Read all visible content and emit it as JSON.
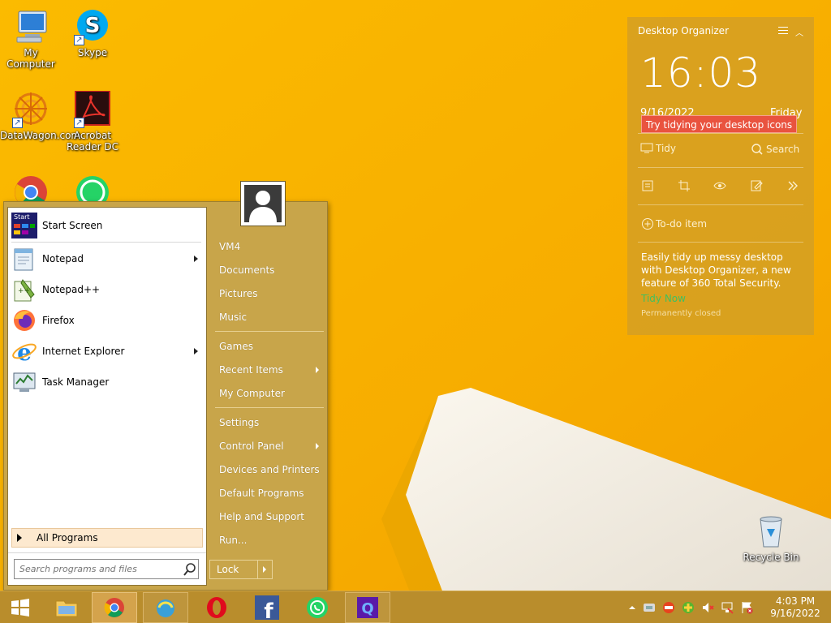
{
  "desktop": {
    "icons": [
      {
        "label": "My Computer"
      },
      {
        "label": "Skype"
      },
      {
        "label": "DataWagon.com"
      },
      {
        "label": "Acrobat Reader DC"
      },
      {
        "label": "Recycle Bin"
      }
    ]
  },
  "start_menu": {
    "programs": [
      {
        "label": "Start Screen",
        "has_submenu": false
      },
      {
        "label": "Notepad",
        "has_submenu": true
      },
      {
        "label": "Notepad++",
        "has_submenu": false
      },
      {
        "label": "Firefox",
        "has_submenu": false
      },
      {
        "label": "Internet Explorer",
        "has_submenu": true
      },
      {
        "label": "Task Manager",
        "has_submenu": false
      }
    ],
    "all_programs": "All Programs",
    "search_placeholder": "Search programs and files",
    "right_items": [
      {
        "label": "VM4",
        "has_submenu": false
      },
      {
        "label": "Documents",
        "has_submenu": false
      },
      {
        "label": "Pictures",
        "has_submenu": false
      },
      {
        "label": "Music",
        "has_submenu": false
      },
      {
        "label": "Games",
        "has_submenu": false
      },
      {
        "label": "Recent Items",
        "has_submenu": true
      },
      {
        "label": "My Computer",
        "has_submenu": false
      },
      {
        "label": "Settings",
        "has_submenu": false
      },
      {
        "label": "Control Panel",
        "has_submenu": true
      },
      {
        "label": "Devices and Printers",
        "has_submenu": false
      },
      {
        "label": "Default Programs",
        "has_submenu": false
      },
      {
        "label": "Help and Support",
        "has_submenu": false
      },
      {
        "label": "Run...",
        "has_submenu": false
      }
    ],
    "lock_label": "Lock",
    "start_screen_icon_text": "Start"
  },
  "organizer": {
    "title": "Desktop Organizer",
    "time": "16:03",
    "date": "9/16/2022",
    "day": "Friday",
    "tip": "Try tidying your desktop icons",
    "tidy_label": "Tidy",
    "search_label": "Search",
    "todo_label": "To-do item",
    "description": "Easily tidy up messy desktop with Desktop Organizer, a new feature of 360 Total Security.",
    "link": "Tidy Now",
    "closed": "Permanently closed"
  },
  "taskbar": {
    "apps": [
      "windows-start",
      "file-explorer",
      "chrome",
      "360-security",
      "opera",
      "facebook",
      "whatsapp",
      "qbittorrent"
    ],
    "clock_time": "4:03 PM",
    "clock_date": "9/16/2022"
  },
  "colors": {
    "wallpaper": "#f7ae00",
    "start_menu_bg": "#c8a54a",
    "taskbar_bg": "#b98d2c",
    "organizer_bg": "#d6a021",
    "tip_bg": "#e9533f"
  }
}
